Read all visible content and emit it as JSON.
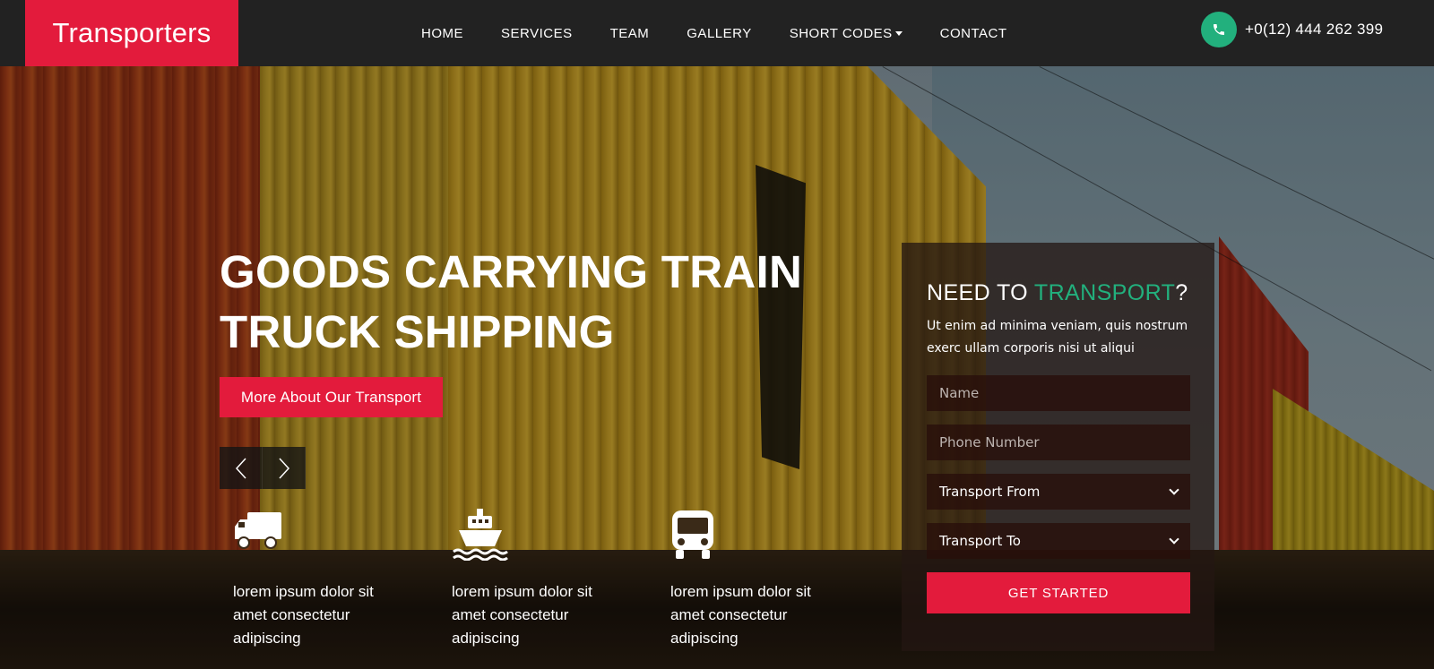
{
  "brand": {
    "name": "Transporters",
    "color": "#e31b3c"
  },
  "nav": {
    "items": [
      {
        "label": "HOME"
      },
      {
        "label": "SERVICES"
      },
      {
        "label": "TEAM"
      },
      {
        "label": "GALLERY"
      },
      {
        "label": "SHORT CODES",
        "dropdown": true
      },
      {
        "label": "CONTACT"
      }
    ]
  },
  "contact": {
    "phone": "+0(12) 444 262 399",
    "icon": "phone-icon",
    "accent": "#22b07d"
  },
  "hero": {
    "title_line1": "GOODS CARRYING TRAIN",
    "title_line2": "TRUCK SHIPPING",
    "cta_label": "More About Our Transport",
    "prev_icon": "chevron-left-icon",
    "next_icon": "chevron-right-icon"
  },
  "features": [
    {
      "icon": "truck-icon",
      "text": "lorem ipsum dolor sit amet consectetur adipiscing"
    },
    {
      "icon": "ship-icon",
      "text": "lorem ipsum dolor sit amet consectetur adipiscing"
    },
    {
      "icon": "bus-icon",
      "text": "lorem ipsum dolor sit amet consectetur adipiscing"
    }
  ],
  "form": {
    "heading_prefix": "NEED TO ",
    "heading_accent": "TRANSPORT",
    "heading_suffix": "?",
    "description": "Ut enim ad minima veniam, quis nostrum exerc ullam corporis nisi ut aliqui",
    "name_placeholder": "Name",
    "phone_placeholder": "Phone Number",
    "from_value": "Transport From",
    "to_value": "Transport To",
    "submit_label": "GET STARTED"
  }
}
